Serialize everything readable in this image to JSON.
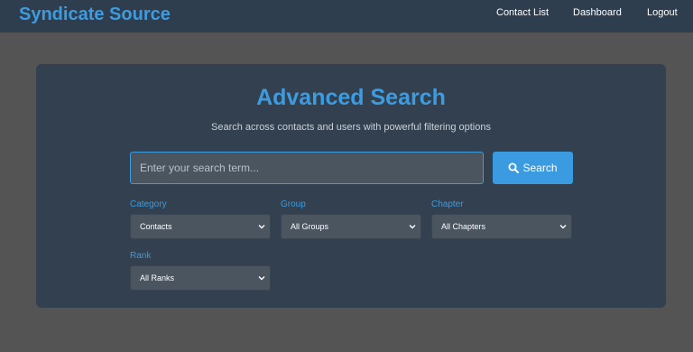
{
  "header": {
    "brand": "Syndicate Source",
    "nav": {
      "contact_list": "Contact List",
      "dashboard": "Dashboard",
      "logout": "Logout"
    }
  },
  "main": {
    "title": "Advanced Search",
    "subtitle": "Search across contacts and users with powerful filtering options",
    "search": {
      "placeholder": "Enter your search term...",
      "value": "",
      "button_label": "Search",
      "button_icon": "search-icon"
    },
    "filters": {
      "category": {
        "label": "Category",
        "selected": "Contacts"
      },
      "group": {
        "label": "Group",
        "selected": "All Groups"
      },
      "chapter": {
        "label": "Chapter",
        "selected": "All Chapters"
      },
      "rank": {
        "label": "Rank",
        "selected": "All Ranks"
      }
    }
  },
  "colors": {
    "accent": "#3d9be0",
    "navbar": "#2f3e4f",
    "panel": "#33404f",
    "page_bg": "#545454",
    "input_bg": "#4a5560"
  }
}
